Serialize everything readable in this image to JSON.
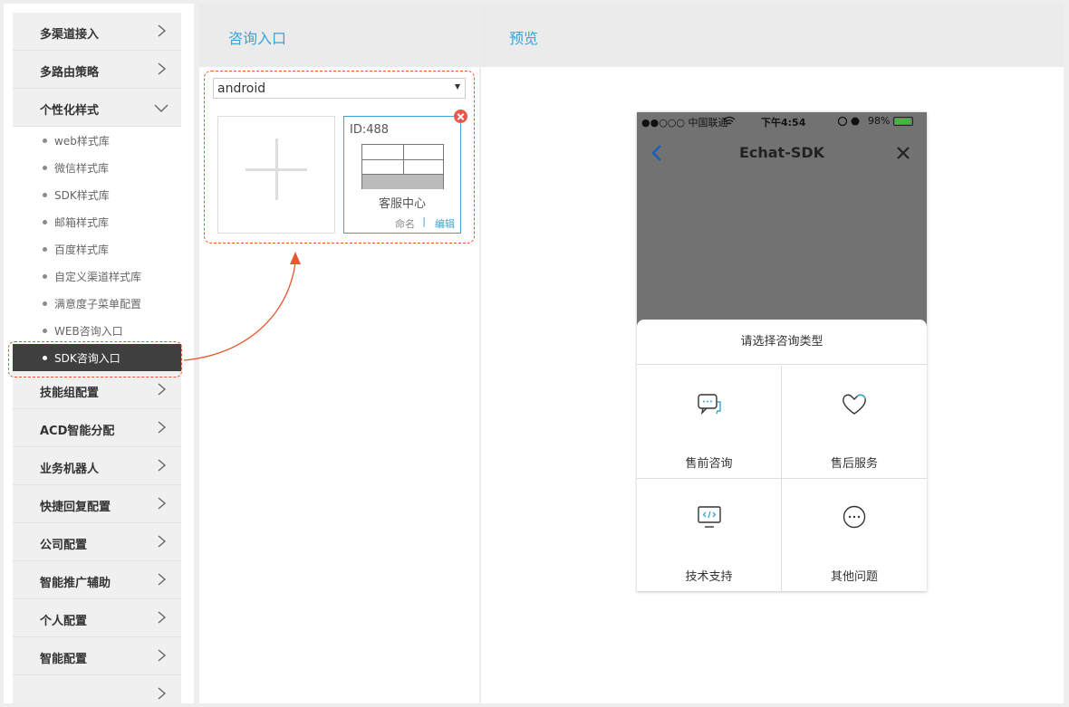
{
  "sidebar": {
    "items_top": [
      {
        "label": "多渠道接入"
      },
      {
        "label": "多路由策略"
      },
      {
        "label": "个性化样式"
      }
    ],
    "sub_items": [
      {
        "label": "web样式库"
      },
      {
        "label": "微信样式库"
      },
      {
        "label": "SDK样式库"
      },
      {
        "label": "邮箱样式库"
      },
      {
        "label": "百度样式库"
      },
      {
        "label": "自定义渠道样式库"
      },
      {
        "label": "满意度子菜单配置"
      },
      {
        "label": "WEB咨询入口"
      },
      {
        "label": "SDK咨询入口"
      }
    ],
    "items_bottom": [
      {
        "label": "技能组配置"
      },
      {
        "label": "ACD智能分配"
      },
      {
        "label": "业务机器人"
      },
      {
        "label": "快捷回复配置"
      },
      {
        "label": "公司配置"
      },
      {
        "label": "智能推广辅助"
      },
      {
        "label": "个人配置"
      },
      {
        "label": "智能配置"
      }
    ]
  },
  "middle": {
    "title": "咨询入口",
    "platform_select": "android",
    "style_card": {
      "id_label": "ID:488",
      "name": "客服中心",
      "rename": "命名",
      "separator": "|",
      "edit": "编辑"
    }
  },
  "preview": {
    "title": "预览",
    "status": {
      "carrier": "●●○○○ 中国联通",
      "time": "下午4:54",
      "battery": "98%"
    },
    "nav_title": "Echat-SDK",
    "sheet_title": "请选择咨询类型",
    "options": [
      {
        "label": "售前咨询",
        "icon": "chat-bubble-icon"
      },
      {
        "label": "售后服务",
        "icon": "heart-icon"
      },
      {
        "label": "技术支持",
        "icon": "monitor-code-icon"
      },
      {
        "label": "其他问题",
        "icon": "ellipsis-circle-icon"
      }
    ]
  },
  "colors": {
    "accent": "#3aa3d6",
    "highlight": "#e8572e",
    "active_nav": "#3f3f3f",
    "delete": "#e8574a"
  }
}
